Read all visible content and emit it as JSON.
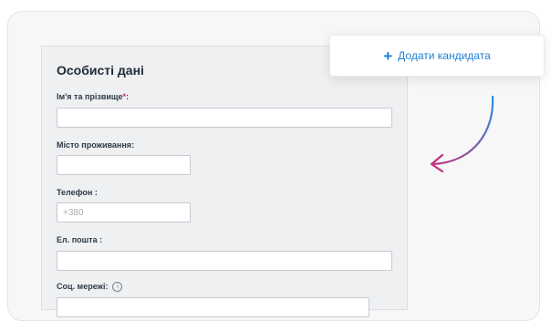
{
  "form": {
    "section_title": "Особисті дані",
    "fields": {
      "full_name": {
        "label": "Ім'я та прізвище",
        "required_mark": "*",
        "colon": ":",
        "value": "",
        "placeholder": ""
      },
      "city": {
        "label": "Місто проживання",
        "colon": ":",
        "value": "",
        "placeholder": ""
      },
      "phone": {
        "label": "Телефон",
        "colon": ":",
        "value": "",
        "placeholder": "+380"
      },
      "email": {
        "label": "Ел. пошта",
        "colon": ":",
        "value": "",
        "placeholder": ""
      },
      "social": {
        "label": "Соц. мережі:",
        "info_glyph": "i",
        "value": "",
        "placeholder": ""
      }
    }
  },
  "add_candidate": {
    "plus_glyph": "+",
    "label": "Додати кандидата"
  },
  "icons": {
    "plus": "plus-icon",
    "info": "info-icon",
    "arrow": "curved-arrow-icon"
  },
  "colors": {
    "accent_blue": "#1f7fd6",
    "required_red": "#e0284f",
    "arrow_blue": "#2b8fe8",
    "arrow_magenta": "#c4337a"
  }
}
